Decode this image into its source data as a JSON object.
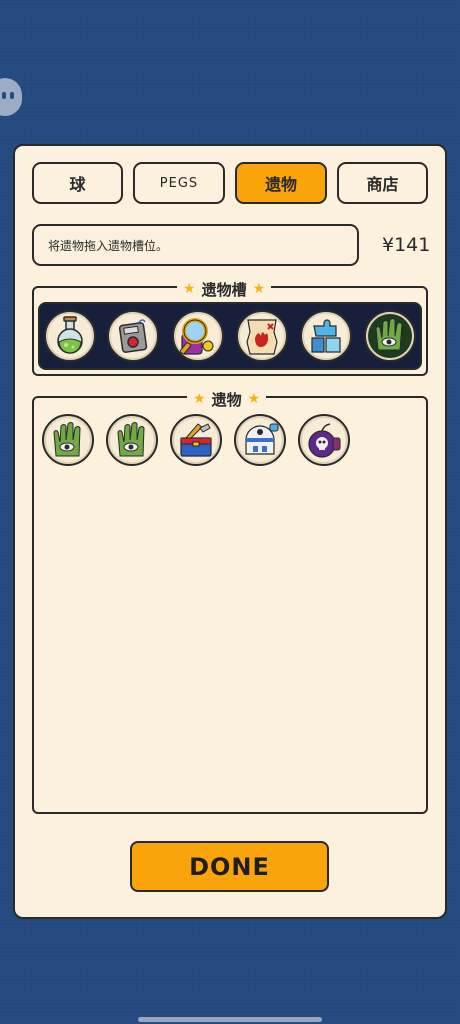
{
  "tabs": [
    {
      "label": "球"
    },
    {
      "label": "PEGS"
    },
    {
      "label": "遗物"
    },
    {
      "label": "商店"
    }
  ],
  "active_tab": "遗物",
  "hint": "将遗物拖入遗物槽位。",
  "money": "¥141",
  "slots_section": {
    "title": "遗物槽",
    "items": [
      "potion-relic",
      "detonator-relic",
      "magnifier-relic",
      "treasure-map-relic",
      "puzzle-pieces-relic",
      "eye-hand-relic"
    ]
  },
  "relics_section": {
    "title": "遗物",
    "items": [
      "eye-hand-relic",
      "eye-hand-relic",
      "toolbox-relic",
      "robot-relic",
      "skull-bomb-relic"
    ]
  },
  "done_label": "DONE",
  "colors": {
    "background": "#244a80",
    "panel": "#fbf1dd",
    "accent": "#f8a40a",
    "slot_bar": "#16203c",
    "star": "#f5b50c"
  }
}
